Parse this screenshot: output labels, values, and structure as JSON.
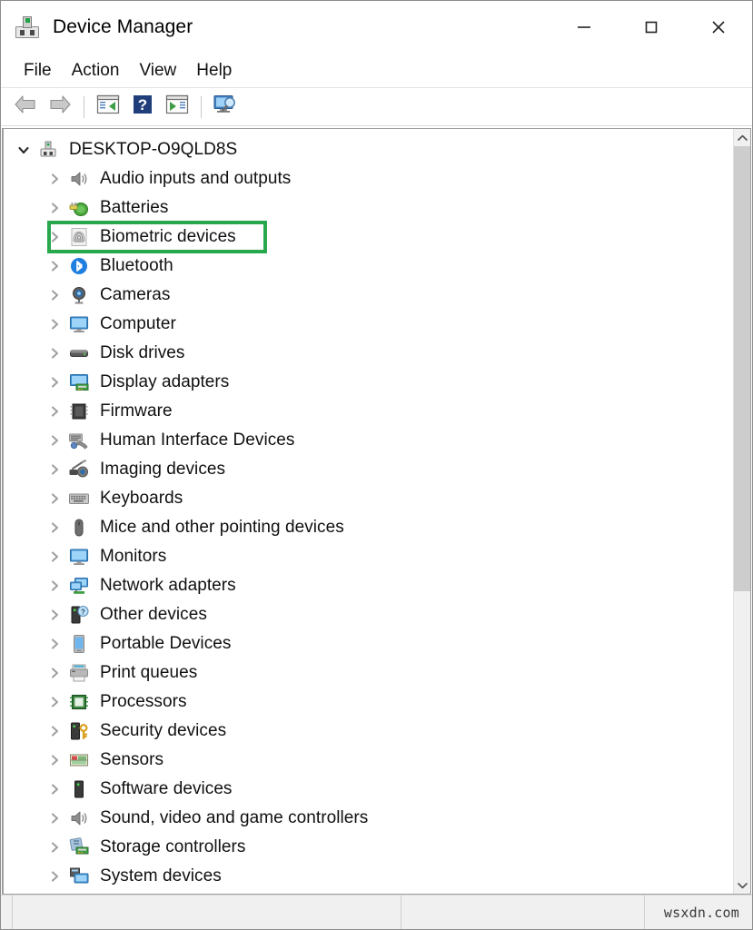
{
  "window": {
    "title": "Device Manager",
    "title_icon": "device-manager-icon",
    "controls": {
      "minimize": "minimize-icon",
      "maximize": "maximize-icon",
      "close": "close-icon"
    }
  },
  "menu": {
    "items": [
      {
        "label": "File",
        "name": "menu-file"
      },
      {
        "label": "Action",
        "name": "menu-action"
      },
      {
        "label": "View",
        "name": "menu-view"
      },
      {
        "label": "Help",
        "name": "menu-help"
      }
    ]
  },
  "toolbar": {
    "buttons": [
      {
        "name": "back-button",
        "icon": "back-arrow-icon"
      },
      {
        "name": "forward-button",
        "icon": "forward-arrow-icon"
      },
      {
        "name": "properties-button",
        "icon": "properties-icon"
      },
      {
        "name": "help-button",
        "icon": "help-question-icon"
      },
      {
        "name": "update-driver-button",
        "icon": "update-driver-icon"
      },
      {
        "name": "scan-hardware-changes-button",
        "icon": "scan-computer-icon"
      }
    ]
  },
  "tree": {
    "root": {
      "label": "DESKTOP-O9QLD8S",
      "icon": "computer-root-icon",
      "expanded": true
    },
    "items": [
      {
        "label": "Audio inputs and outputs",
        "icon": "speaker-icon"
      },
      {
        "label": "Batteries",
        "icon": "battery-icon"
      },
      {
        "label": "Biometric devices",
        "icon": "fingerprint-icon",
        "highlighted": true
      },
      {
        "label": "Bluetooth",
        "icon": "bluetooth-icon"
      },
      {
        "label": "Cameras",
        "icon": "camera-icon"
      },
      {
        "label": "Computer",
        "icon": "monitor-icon"
      },
      {
        "label": "Disk drives",
        "icon": "disk-drive-icon"
      },
      {
        "label": "Display adapters",
        "icon": "display-adapter-icon"
      },
      {
        "label": "Firmware",
        "icon": "chip-icon"
      },
      {
        "label": "Human Interface Devices",
        "icon": "hid-icon"
      },
      {
        "label": "Imaging devices",
        "icon": "imaging-icon"
      },
      {
        "label": "Keyboards",
        "icon": "keyboard-icon"
      },
      {
        "label": "Mice and other pointing devices",
        "icon": "mouse-icon"
      },
      {
        "label": "Monitors",
        "icon": "monitor-icon"
      },
      {
        "label": "Network adapters",
        "icon": "network-adapter-icon"
      },
      {
        "label": "Other devices",
        "icon": "unknown-device-icon"
      },
      {
        "label": "Portable Devices",
        "icon": "portable-device-icon"
      },
      {
        "label": "Print queues",
        "icon": "printer-icon"
      },
      {
        "label": "Processors",
        "icon": "processor-icon"
      },
      {
        "label": "Security devices",
        "icon": "security-device-icon"
      },
      {
        "label": "Sensors",
        "icon": "sensor-icon"
      },
      {
        "label": "Software devices",
        "icon": "software-device-icon"
      },
      {
        "label": "Sound, video and game controllers",
        "icon": "speaker-icon"
      },
      {
        "label": "Storage controllers",
        "icon": "storage-controller-icon"
      },
      {
        "label": "System devices",
        "icon": "system-device-icon"
      }
    ],
    "highlight_color": "#27a84d"
  },
  "scrollbar": {
    "up_arrow": "chevron-up-icon",
    "down_arrow": "chevron-down-icon",
    "thumb_position_percent": 0,
    "thumb_size_percent": 61
  },
  "statusbar": {
    "cells": [
      "",
      "",
      "",
      ""
    ],
    "watermark": "wsxdn.com"
  }
}
